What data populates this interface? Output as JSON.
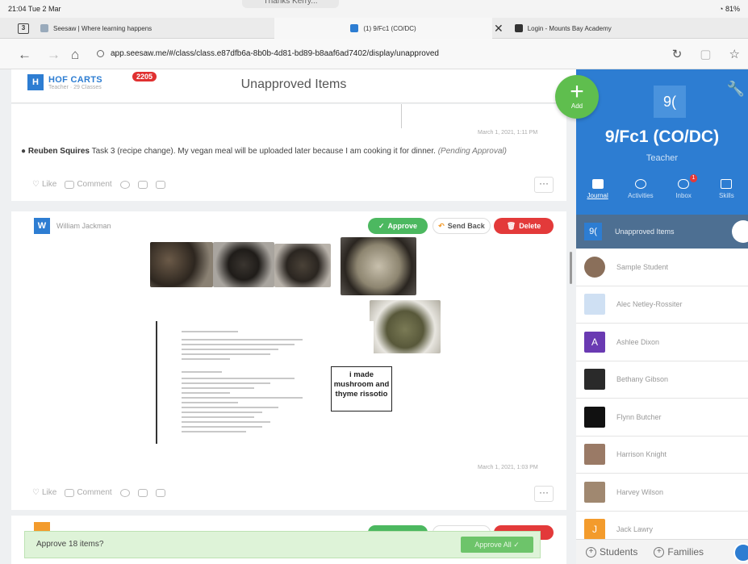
{
  "status": {
    "time": "21:04  Tue 2 Mar",
    "notification": "Thanks Kerry...",
    "battery": "81%"
  },
  "tabs": [
    {
      "label": "Seesaw | Where learning happens",
      "color": "#9aa"
    },
    {
      "label": "(1) 9/Fc1 (CO/DC)",
      "color": "#2d7dd2"
    },
    {
      "label": "Login - Mounts Bay Academy",
      "color": "#333"
    }
  ],
  "tab_count": "3",
  "url": "app.seesaw.me/#/class/class.e87dfb6a-8b0b-4d81-bd89-b8aaf6ad7402/display/unapproved",
  "header": {
    "class_initial": "H",
    "class_name": "HOF CARTS",
    "class_sub": "Teacher · 29 Classes",
    "badge_count": "2205",
    "title": "Unapproved Items"
  },
  "add_button": {
    "label": "Add"
  },
  "posts": [
    {
      "date": "March 1, 2021, 1:11 PM",
      "author": "Reuben Squires",
      "text": "Task 3 (recipe change). My vegan meal will be uploaded later because I am cooking it for dinner.",
      "status": "(Pending Approval)",
      "like": "Like",
      "comment": "Comment",
      "more": "···"
    },
    {
      "initial": "W",
      "author": "William Jackman",
      "approve": "Approve",
      "send_back": "Send Back",
      "delete": "Delete",
      "caption": "i made mushroom and thyme rissotio",
      "date": "March 1, 2021, 1:03 PM",
      "like": "Like",
      "comment": "Comment",
      "more": "···"
    }
  ],
  "approve_bar": {
    "text": "Approve 18 items?",
    "button": "Approve All ✓"
  },
  "sidebar": {
    "class_icon": "9(",
    "class_name": "9/Fc1 (CO/DC)",
    "role": "Teacher",
    "tabs": [
      {
        "label": "Journal"
      },
      {
        "label": "Activities"
      },
      {
        "label": "Inbox",
        "badge": "1"
      },
      {
        "label": "Skills"
      }
    ],
    "unapproved": {
      "icon": "9(",
      "label": "Unapproved Items"
    },
    "students": [
      {
        "name": "Sample Student",
        "initial": "",
        "color": "#8a6f5a"
      },
      {
        "name": "Alec Netley-Rossiter",
        "initial": "",
        "color": "#cfe0f3"
      },
      {
        "name": "Ashlee Dixon",
        "initial": "A",
        "color": "#6a3ab2"
      },
      {
        "name": "Bethany Gibson",
        "initial": "",
        "color": "#2a2a2a"
      },
      {
        "name": "Flynn Butcher",
        "initial": "",
        "color": "#111111"
      },
      {
        "name": "Harrison Knight",
        "initial": "",
        "color": "#9a7a66"
      },
      {
        "name": "Harvey Wilson",
        "initial": "",
        "color": "#a08870"
      },
      {
        "name": "Jack Lawry",
        "initial": "J",
        "color": "#f39b2c"
      }
    ],
    "footer": {
      "students": "Students",
      "families": "Families"
    }
  }
}
